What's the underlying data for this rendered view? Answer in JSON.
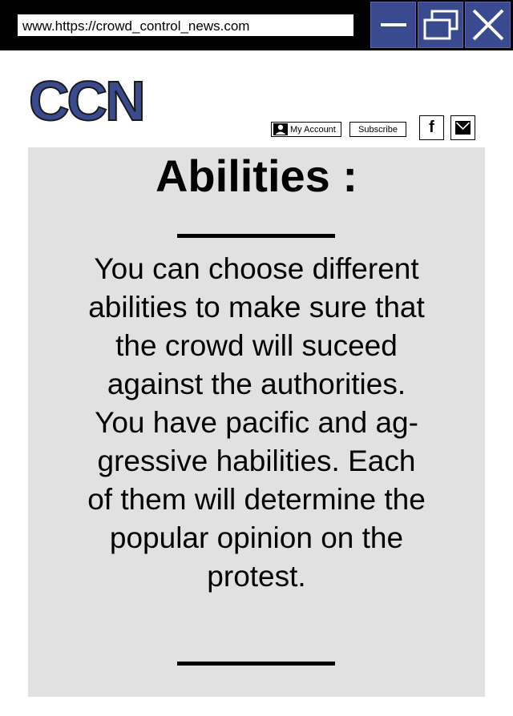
{
  "browser": {
    "url": "www.https://crowd_control_news.com",
    "window_buttons": {
      "minimize_icon": "minimize-icon",
      "maximize_icon": "restore-icon",
      "close_icon": "close-icon"
    },
    "button_color": "#3a4a8e"
  },
  "site": {
    "logo": "CCN",
    "brand_color": "#3a4a8e"
  },
  "header": {
    "account_label": "My Account",
    "subscribe_label": "Subscribe",
    "facebook_label": "f",
    "mail_icon": "mail-icon"
  },
  "article": {
    "title": "Abilities :",
    "lines": [
      "You can choose different",
      "abilities to make sure that",
      "the crowd will suceed",
      "against the authorities.",
      "You have pacific and ag-",
      "gressive habilities. Each",
      "of them will determine the",
      "popular opinion on the",
      "protest."
    ],
    "panel_color": "#e1e1e1"
  }
}
